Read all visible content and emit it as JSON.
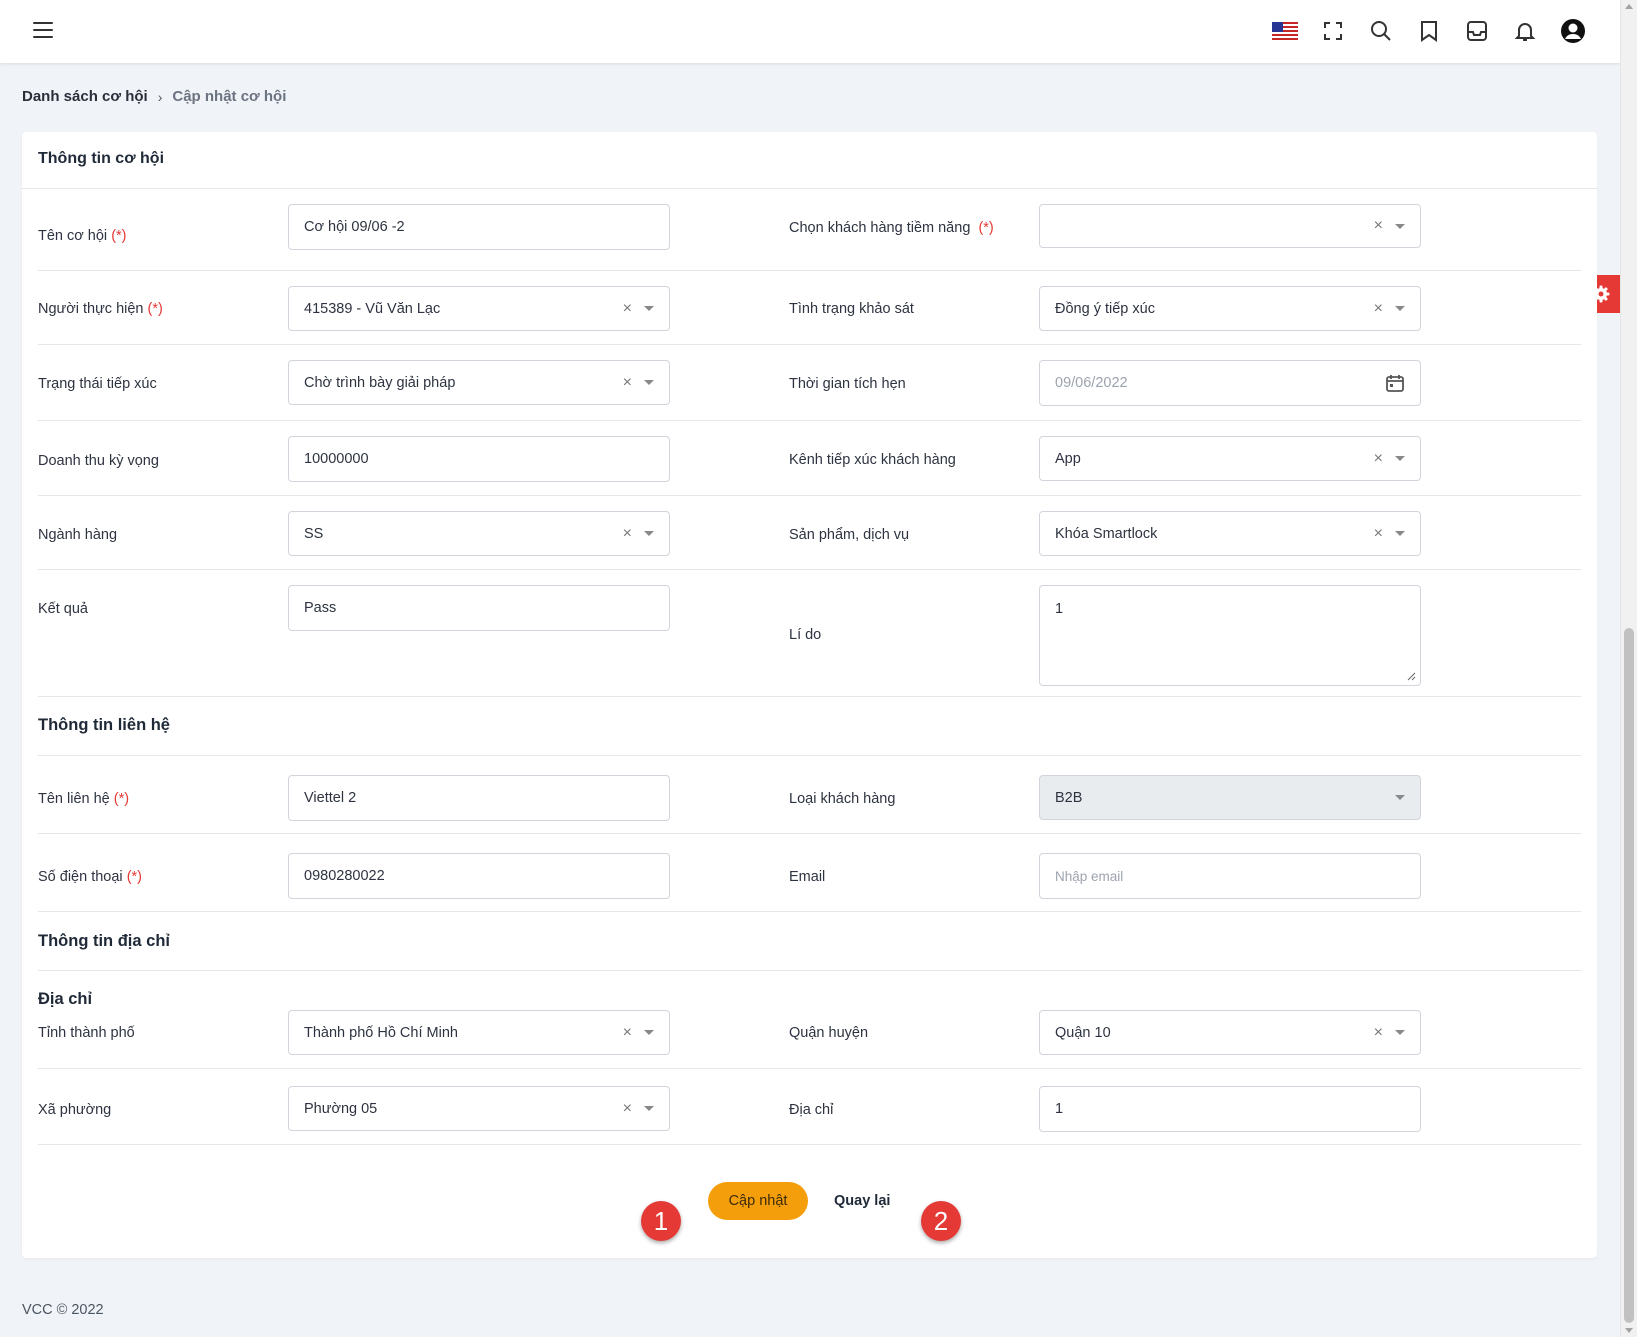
{
  "breadcrumb": {
    "parent": "Danh sách cơ hội",
    "separator": "›",
    "current": "Cập nhật cơ hội"
  },
  "card": {
    "title": "Thông tin cơ hội"
  },
  "fields": {
    "ten_co_hoi": {
      "label": "Tên cơ hội",
      "value": "Cơ hội 09/06 -2"
    },
    "khach_hang_tiem_nang": {
      "label": "Chọn khách hàng tiềm năng",
      "value": ""
    },
    "nguoi_thuc_hien": {
      "label": "Người thực hiện",
      "value": "415389 - Vũ Văn Lạc"
    },
    "tinh_trang_khao_sat": {
      "label": "Tình trạng khảo sát",
      "value": "Đồng ý tiếp xúc"
    },
    "trang_thai_tiep_xuc": {
      "label": "Trạng thái tiếp xúc",
      "value": "Chờ trình bày giải pháp"
    },
    "thoi_gian_tich_hen": {
      "label": "Thời gian tích hẹn",
      "value": "09/06/2022"
    },
    "doanh_thu_ky_vong": {
      "label": "Doanh thu kỳ vọng",
      "value": "10000000"
    },
    "kenh_tiep_xuc": {
      "label": "Kênh tiếp xúc khách hàng",
      "value": "App"
    },
    "nganh_hang": {
      "label": "Ngành hàng",
      "value": "SS"
    },
    "san_pham_dich_vu": {
      "label": "Sản phẩm, dịch vụ",
      "value": "Khóa Smartlock"
    },
    "ket_qua": {
      "label": "Kết quả",
      "value": "Pass"
    },
    "li_do": {
      "label": "Lí do",
      "value": "1"
    }
  },
  "contact": {
    "title": "Thông tin liên hệ",
    "ten_lien_he": {
      "label": "Tên liên hệ",
      "value": "Viettel 2"
    },
    "loai_khach_hang": {
      "label": "Loại khách hàng",
      "value": "B2B"
    },
    "so_dien_thoai": {
      "label": "Số điện thoại",
      "value": "0980280022"
    },
    "email": {
      "label": "Email",
      "placeholder": "Nhập email"
    }
  },
  "address": {
    "title": "Thông tin địa chỉ",
    "subtitle": "Địa chỉ",
    "tinh_thanh_pho": {
      "label": "Tỉnh thành phố",
      "value": "Thành phố Hồ Chí Minh"
    },
    "quan_huyen": {
      "label": "Quận huyện",
      "value": "Quận 10"
    },
    "xa_phuong": {
      "label": "Xã phường",
      "value": "Phường 05"
    },
    "dia_chi": {
      "label": "Địa chỉ",
      "value": "1"
    }
  },
  "required_mark": "(*)",
  "clear_symbol": "×",
  "actions": {
    "update": "Cập nhật",
    "back": "Quay lại"
  },
  "markers": {
    "m1": "1",
    "m2": "2"
  },
  "footer": "VCC © 2022",
  "icons": {
    "top": [
      "us-flag-icon",
      "fullscreen-icon",
      "search-icon",
      "bookmark-icon",
      "inbox-icon",
      "bell-icon",
      "user-account-icon"
    ],
    "settings": "gear-icon",
    "calendar": "calendar-icon"
  },
  "colors": {
    "accent": "#f59e0b",
    "required": "#e53935",
    "marker": "#e53935",
    "settings_tab": "#e53935"
  }
}
